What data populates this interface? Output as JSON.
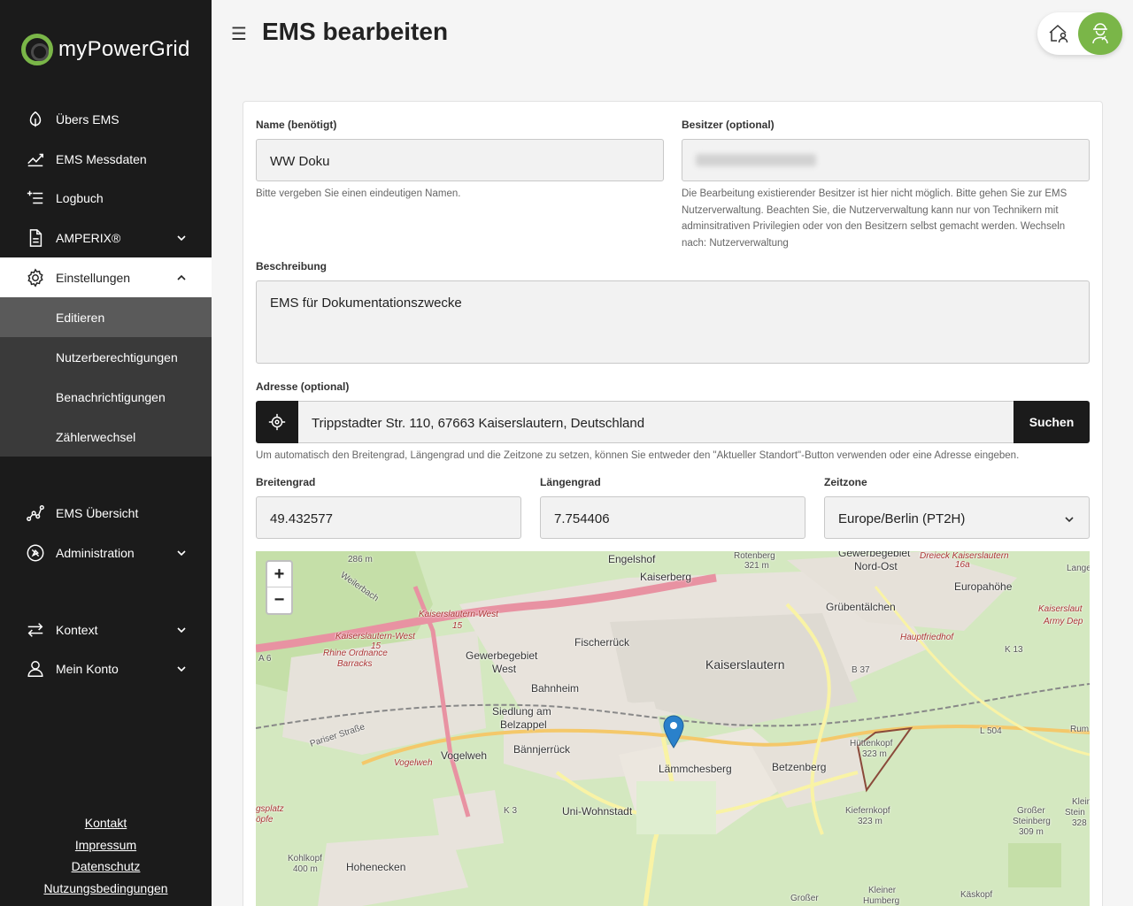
{
  "brand": {
    "name": "myPowerGrid"
  },
  "sidebar": {
    "items": [
      {
        "label": "Übers EMS"
      },
      {
        "label": "EMS Messdaten"
      },
      {
        "label": "Logbuch"
      },
      {
        "label": "AMPERIX®"
      },
      {
        "label": "Einstellungen"
      },
      {
        "label": "EMS Übersicht"
      },
      {
        "label": "Administration"
      },
      {
        "label": "Kontext"
      },
      {
        "label": "Mein Konto"
      }
    ],
    "subitems": [
      {
        "label": "Editieren"
      },
      {
        "label": "Nutzerberechtigungen"
      },
      {
        "label": "Benachrichtigungen"
      },
      {
        "label": "Zählerwechsel"
      }
    ],
    "footer": [
      "Kontakt",
      "Impressum",
      "Datenschutz",
      "Nutzungsbedingungen"
    ]
  },
  "header": {
    "title": "EMS bearbeiten",
    "menu_icon": "☰"
  },
  "form": {
    "name": {
      "label": "Name (benötigt)",
      "value": "WW Doku",
      "help": "Bitte vergeben Sie einen eindeutigen Namen."
    },
    "owner": {
      "label": "Besitzer (optional)",
      "help": "Die Bearbeitung existierender Besitzer ist hier nicht möglich. Bitte gehen Sie zur EMS Nutzerverwaltung. Beachten Sie, die Nutzerverwaltung kann nur von Technikern mit adminsitrativen Privilegien oder von den Besitzern selbst gemacht werden. Wechseln nach: Nutzerverwaltung"
    },
    "description": {
      "label": "Beschreibung",
      "value": "EMS für Dokumentationszwecke"
    },
    "address": {
      "label": "Adresse (optional)",
      "value": "Trippstadter Str. 110, 67663 Kaiserslautern, Deutschland",
      "search_label": "Suchen",
      "help": "Um automatisch den Breitengrad, Längengrad und die Zeitzone zu setzen, können Sie entweder den \"Aktueller Standort\"-Button verwenden oder eine Adresse eingeben."
    },
    "latitude": {
      "label": "Breitengrad",
      "value": "49.432577"
    },
    "longitude": {
      "label": "Längengrad",
      "value": "7.754406"
    },
    "timezone": {
      "label": "Zeitzone",
      "value": "Europe/Berlin (PT2H)"
    }
  },
  "map": {
    "zoom_in": "+",
    "zoom_out": "−",
    "labels": {
      "l1": "Engelshof",
      "l2": "Kaiserberg",
      "l3": "Rotenberg",
      "l4": "321 m",
      "l5": "Gewerbegebiet",
      "l6": "Nord-Ost",
      "l7": "Europahöhe",
      "l8": "Grübentälchen",
      "l9": "Fischerrück",
      "l10": "Gewerbegebiet",
      "l11": "West",
      "l12": "Kaiserslautern",
      "l13": "Bahnheim",
      "l14": "Siedlung am",
      "l15": "Belzappel",
      "l16": "Vogelweh",
      "l17": "Bännjerrück",
      "l18": "Lämmchesberg",
      "l19": "Betzenberg",
      "l20": "Uni-Wohnstadt",
      "l21": "Hohenecken",
      "l22": "Hüttenkopf",
      "l23": "323 m",
      "l24": "Kiefernkopf",
      "l25": "323 m",
      "l26": "Großer",
      "l27": "Steinberg",
      "l28": "309 m",
      "l29": "Kohlkopf",
      "l30": "400 m",
      "l31": "Hauptfriedhof",
      "l32": "Kaiserslautern-West",
      "l33": "Kaiserslautern-West",
      "l34": "Rhine Ordnance",
      "l35": "Barracks",
      "l36": "Weilerbach",
      "l37": "Vogelweh",
      "l38": "Pariser Straße",
      "l39": "A 6",
      "l40": "B 37",
      "l41": "K 13",
      "l42": "L 504",
      "l43": "K 3",
      "l44": "Kaiserslaut",
      "l45": "Army Dep",
      "l46": "Dreieck Kaiserslautern",
      "l47": "Großer",
      "l48": "Kleiner",
      "l49": "Humberg",
      "l50": "Käskopf",
      "l51": "286 m",
      "l52": "15",
      "l53": "15",
      "l54": "16a",
      "l55": "Lange",
      "l56": "Rum",
      "l57": "Klein",
      "l58": "Stein",
      "l59": "328",
      "l60": "gsplatz",
      "l61": "öpfe"
    }
  },
  "colors": {
    "accent": "#7ab648",
    "sidebar_bg": "#1b1b1b",
    "sub_bg": "#3a3a3a",
    "sub_active": "#5a5a5a",
    "marker": "#2a81cb"
  }
}
